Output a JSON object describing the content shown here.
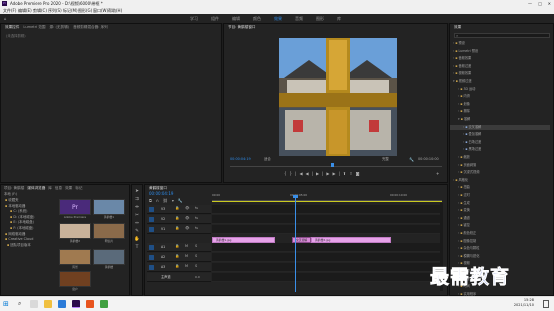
{
  "window": {
    "title": "Adobe Premiere Pro 2020 - D:\\视频\\6000\\带框 *"
  },
  "menubar": {
    "items": [
      "文件(F)",
      "编辑(E)",
      "剪辑(C)",
      "序列(S)",
      "标记(M)",
      "图形(G)",
      "窗口(W)",
      "帮助(H)"
    ]
  },
  "workspaces": {
    "items": [
      "学习",
      "组件",
      "编辑",
      "颜色",
      "效果",
      "音频",
      "图形",
      "库"
    ],
    "active_index": 4
  },
  "source_panel": {
    "tabs": [
      "效果控件",
      "Lumetri 范围",
      "源: (无剪辑)",
      "音频剪辑混合器: 序列"
    ],
    "active_tab": "效果控件",
    "placeholder": "(未选择剪辑)"
  },
  "program_monitor": {
    "title": "节目: 黄鹤楼窗口",
    "timecode_in": "00:00:04:19",
    "fit": "适合",
    "quality": "完整",
    "timecode_out": "00:00:10:00"
  },
  "project_panel": {
    "tabs": [
      "项目: 黄鹤楼",
      "媒体浏览器",
      "库",
      "信息",
      "效果",
      "标记"
    ],
    "active_tab": "媒体浏览器",
    "location": "本地 (F:)",
    "tree": [
      "收藏夹",
      "本地驱动器",
      "C: (系统)",
      "D: (本地磁盘)",
      "E: (本地磁盘)",
      "F: (本地磁盘)",
      "网络驱动器",
      "Creative Cloud",
      "团队项目版本"
    ],
    "thumbs": [
      {
        "name": "Adobe Premiere",
        "type": "pr"
      },
      {
        "name": "黄鹤楼1",
        "type": "img"
      },
      {
        "name": "黄鹤楼2",
        "type": "img"
      },
      {
        "name": "明信片",
        "type": "img"
      },
      {
        "name": "风景",
        "type": "img"
      },
      {
        "name": "黄鹤楼",
        "type": "img"
      },
      {
        "name": "窗户",
        "type": "img"
      }
    ]
  },
  "timeline": {
    "title": "黄鹤楼窗口",
    "timecode": "00:00:04:19",
    "ruler_labels": [
      "00:00",
      "00:00:05:00",
      "00:00:10:00"
    ],
    "tracks": [
      "V3",
      "V2",
      "V1",
      "A1",
      "A2",
      "A3",
      "主声道"
    ],
    "master_value": "0.0",
    "clips": [
      {
        "label": "黄鹤楼1.jpg",
        "track": "V1"
      },
      {
        "label": "交叉溶解",
        "track": "V1"
      },
      {
        "label": "黄鹤楼2.jpg",
        "track": "V1"
      }
    ]
  },
  "effects_panel": {
    "title": "效果",
    "items": [
      "预设",
      "Lumetri 预设",
      "音频效果",
      "音频过渡",
      "视频效果",
      "视频过渡",
      "3D 运动",
      "内滑",
      "划像",
      "擦除",
      "溶解",
      "交叉溶解",
      "叠加溶解",
      "白场过渡",
      "黑场过渡",
      "缩放",
      "页面剥落",
      "沉浸式视频",
      "风格化",
      "扭曲",
      "过时",
      "生成",
      "变换",
      "通道",
      "键控",
      "颜色校正",
      "图像控制",
      "杂色与颗粒",
      "模糊与锐化",
      "视频",
      "调整",
      "透视",
      "时间",
      "实用程序"
    ]
  },
  "taskbar": {
    "time": "15:28",
    "date": "2021/11/10"
  },
  "watermark": {
    "text": "最需教育"
  },
  "colors": {
    "accent": "#2d8ceb",
    "clip": "#e6a2e9",
    "playhead": "#3a8fe8"
  }
}
